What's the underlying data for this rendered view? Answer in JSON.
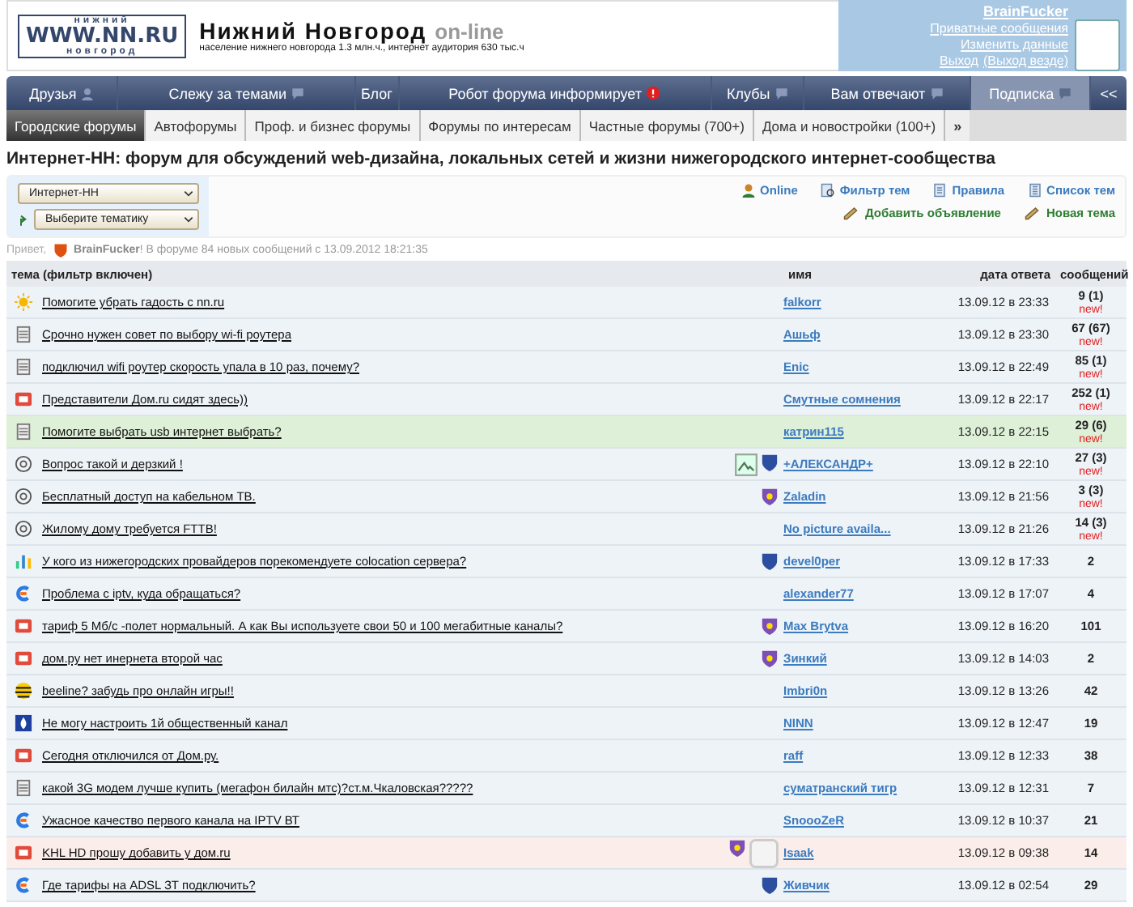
{
  "header": {
    "logo_top": "нижний",
    "logo": "WWW.NN.RU",
    "logo_bottom": "новгород",
    "title": "Нижний Новгород",
    "title_suffix": "on-line",
    "subtitle": "население нижнего новгорода 1.3 млн.ч., интернет аудитория 630 тыс.ч"
  },
  "user_box": {
    "name": "BrainFucker",
    "links": [
      "Приватные сообщения",
      "Изменить данные"
    ],
    "logout": "Выход",
    "logout_all": "(Выход везде)"
  },
  "nav": [
    {
      "label": "Друзья",
      "kind": "person",
      "selected": false
    },
    {
      "label": "Слежу за темами",
      "kind": "bubble",
      "selected": false
    },
    {
      "label": "Блог",
      "kind": "plain",
      "selected": false
    },
    {
      "label": "Робот форума информирует",
      "kind": "alert",
      "selected": false
    },
    {
      "label": "Клубы",
      "kind": "bubble",
      "selected": false
    },
    {
      "label": "Вам отвечают",
      "kind": "bubble",
      "selected": false
    },
    {
      "label": "Подписка",
      "kind": "bubble",
      "selected": true
    }
  ],
  "nav_collapse": "<<",
  "tabs": [
    {
      "label": "Городские форумы",
      "selected": true
    },
    {
      "label": "Автофорумы",
      "selected": false
    },
    {
      "label": "Проф. и бизнес форумы",
      "selected": false
    },
    {
      "label": "Форумы по интересам",
      "selected": false
    },
    {
      "label": "Частные форумы (700+)",
      "selected": false
    },
    {
      "label": "Дома и новостройки (100+)",
      "selected": false
    }
  ],
  "tabs_more": "»",
  "heading": "Интернет-НН: форум для обсуждений web-дизайна, локальных сетей и жизни нижегородского интернет-сообщества",
  "forum_select": {
    "value": "Интернет-НН"
  },
  "topic_select": {
    "value": "Выберите тематику"
  },
  "actions": [
    {
      "label": "Online",
      "kind": "person"
    },
    {
      "label": "Фильтр тем",
      "kind": "filter"
    },
    {
      "label": "Правила",
      "kind": "doc"
    },
    {
      "label": "Список тем",
      "kind": "list"
    }
  ],
  "actions_green": [
    {
      "label": "Добавить объявление",
      "kind": "pencil"
    },
    {
      "label": "Новая тема",
      "kind": "pencil"
    }
  ],
  "greeting": {
    "prefix": "Привет,",
    "text": "**BrainFucker**! В форуме 84 новых сообщений с 13.09.2012 18:21:35"
  },
  "table": {
    "columns": [
      "тема (фильтр включен)",
      "имя",
      "дата ответа",
      "сообщений"
    ],
    "rows": [
      {
        "kind": "sun",
        "title": "Помогите убрать гадость с nn.ru",
        "author": "falkorr",
        "date": "13.09.12 в 23:33",
        "count": "9 (1)",
        "new": "new!",
        "color": "#eef3f8",
        "badges": []
      },
      {
        "kind": "note",
        "title": "Срочно нужен совет по выбору wi-fi роутера",
        "author": "Ашьф",
        "date": "13.09.12 в 23:30",
        "count": "67 (67)",
        "new": "new!",
        "color": "#eef3f8",
        "badges": []
      },
      {
        "kind": "note",
        "title": "подключил wifi роутер скорость упала в 10 раз, почему?",
        "author": "Enic",
        "date": "13.09.12 в 22:49",
        "count": "85 (1)",
        "new": "new!",
        "color": "#eef3f8",
        "badges": []
      },
      {
        "kind": "tv",
        "title": "Представители Дом.ru сидят здесь))",
        "author": "Смутные сомнения",
        "date": "13.09.12 в 22:17",
        "count": "252 (1)",
        "new": "new!",
        "color": "#eef3f8",
        "badges": []
      },
      {
        "kind": "note",
        "title": "Помогите выбрать usb интернет выбрать?",
        "author": "катрин115",
        "date": "13.09.12 в 22:15",
        "count": "29 (6)",
        "new": "new!",
        "color": "#dff0d8",
        "badges": []
      },
      {
        "kind": "at",
        "title": "Вопрос такой и дерзкий !",
        "author": "+АЛЕКСАНДР+",
        "date": "13.09.12 в 22:10",
        "count": "27 (3)",
        "new": "new!",
        "color": "#eef3f8",
        "badges": [
          {
            "kind": "picture"
          },
          {
            "kind": "shield"
          }
        ]
      },
      {
        "kind": "at",
        "title": "Бесплатный доступ на кабельном ТВ.",
        "author": "Zaladin",
        "date": "13.09.12 в 21:56",
        "count": "3 (3)",
        "new": "new!",
        "color": "#eef3f8",
        "badges": [
          {
            "kind": "crest"
          }
        ]
      },
      {
        "kind": "at",
        "title": "Жилому дому требуется FTTB!",
        "author": "No picture availa...",
        "date": "13.09.12 в 21:26",
        "count": "14 (3)",
        "new": "new!",
        "color": "#eef3f8",
        "badges": []
      },
      {
        "kind": "bars",
        "title": "У кого из нижегородских провайдеров порекомендуете colocation сервера?",
        "author": "devel0per",
        "date": "13.09.12 в 17:33",
        "count": "2",
        "new": "",
        "color": "#eef3f8",
        "badges": [
          {
            "kind": "shield"
          }
        ]
      },
      {
        "kind": "e",
        "title": "Проблема с iptv, куда обращаться?",
        "author": "alexander77",
        "date": "13.09.12 в 17:07",
        "count": "4",
        "new": "",
        "color": "#eef3f8",
        "badges": []
      },
      {
        "kind": "tv",
        "title": "тариф 5 Мб/с -полет нормальный. А как Вы используете свои 50 и 100 мегабитные каналы?",
        "author": "Max Brytva",
        "date": "13.09.12 в 16:20",
        "count": "101",
        "new": "",
        "color": "#eef3f8",
        "badges": [
          {
            "kind": "crest"
          }
        ]
      },
      {
        "kind": "tv",
        "title": "дом.ру нет инернета второй час",
        "author": "Зинкий",
        "date": "13.09.12 в 14:03",
        "count": "2",
        "new": "",
        "color": "#eef3f8",
        "badges": [
          {
            "kind": "crest"
          }
        ]
      },
      {
        "kind": "stripes",
        "title": "beeline? забудь про онлайн игры!!",
        "author": "Imbri0n",
        "date": "13.09.12 в 13:26",
        "count": "42",
        "new": "",
        "color": "#eef3f8",
        "badges": []
      },
      {
        "kind": "drop",
        "title": "Не могу настроить 1й общественный канал",
        "author": "NINN",
        "date": "13.09.12 в 12:47",
        "count": "19",
        "new": "",
        "color": "#eef3f8",
        "badges": []
      },
      {
        "kind": "tv",
        "title": "Сегодня отключился от Дом.ру.",
        "author": "raff",
        "date": "13.09.12 в 12:33",
        "count": "38",
        "new": "",
        "color": "#eef3f8",
        "badges": []
      },
      {
        "kind": "note",
        "title": "какой 3G модем лучше купить (мегафон билайн мтс)?ст.м.Чкаловская?????",
        "author": "суматранский тигр",
        "date": "13.09.12 в 12:31",
        "count": "7",
        "new": "",
        "color": "#eef3f8",
        "badges": []
      },
      {
        "kind": "e",
        "title": "Ужасное качество первого канала на IPTV ВТ",
        "author": "SnoooZeR",
        "date": "13.09.12 в 10:37",
        "count": "21",
        "new": "",
        "color": "#eef3f8",
        "badges": []
      },
      {
        "kind": "tv",
        "title": "KHL HD прошу добавить у дом.ru",
        "author": "Isaak",
        "date": "13.09.12 в 09:38",
        "count": "14",
        "new": "",
        "color": "#fbeeea",
        "badges": [
          {
            "kind": "crest"
          },
          {
            "kind": "avatar"
          }
        ]
      },
      {
        "kind": "e",
        "title": "Где тарифы на ADSL ЗТ подключить?",
        "author": "Живчик",
        "date": "13.09.12 в 02:54",
        "count": "29",
        "new": "",
        "color": "#eef3f8",
        "badges": [
          {
            "kind": "shield"
          }
        ]
      }
    ]
  }
}
